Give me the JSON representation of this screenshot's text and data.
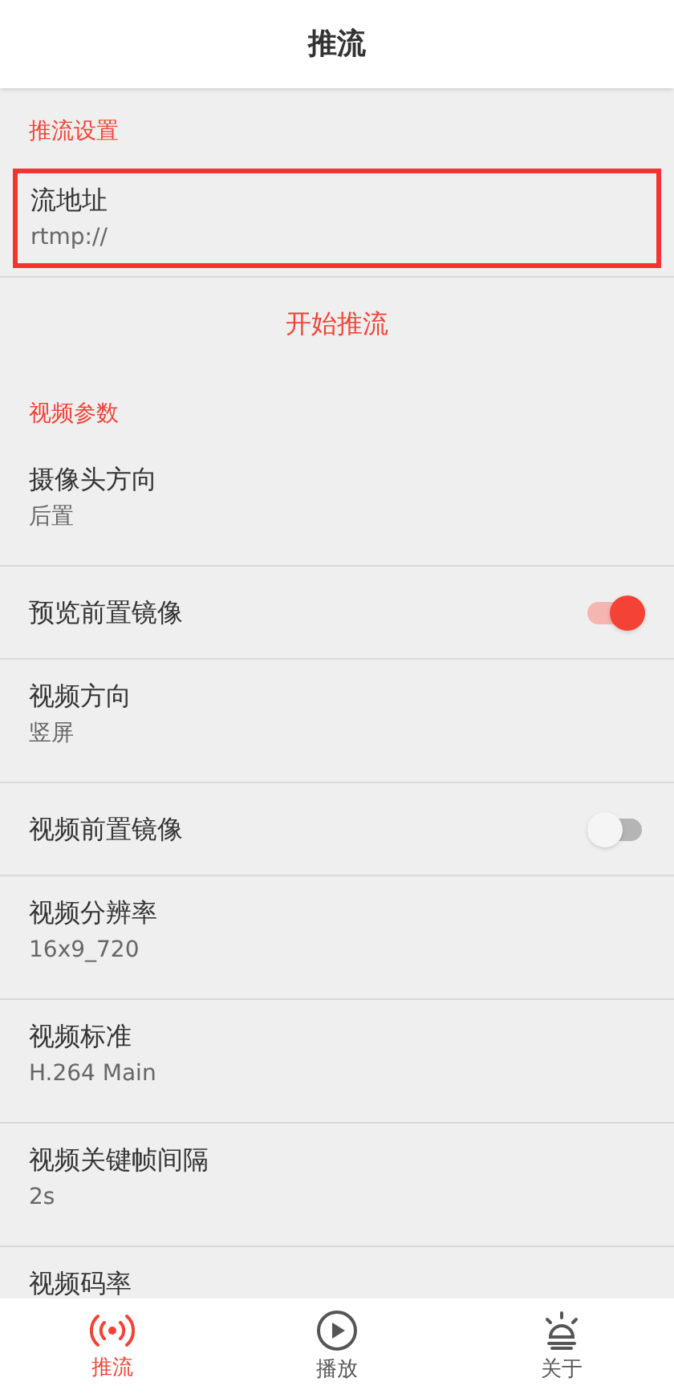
{
  "title": "推流",
  "sections": [
    {
      "header": "推流设置",
      "items": [
        {
          "kind": "value",
          "title": "流地址",
          "value": "rtmp://",
          "highlighted": true
        }
      ],
      "action": "开始推流"
    },
    {
      "header": "视频参数",
      "items": [
        {
          "kind": "value",
          "title": "摄像头方向",
          "value": "后置"
        },
        {
          "kind": "switch",
          "title": "预览前置镜像",
          "on": true
        },
        {
          "kind": "value",
          "title": "视频方向",
          "value": "竖屏"
        },
        {
          "kind": "switch",
          "title": "视频前置镜像",
          "on": false
        },
        {
          "kind": "value",
          "title": "视频分辨率",
          "value": "16x9_720"
        },
        {
          "kind": "value",
          "title": "视频标准",
          "value": "H.264 Main"
        },
        {
          "kind": "value",
          "title": "视频关键帧间隔",
          "value": "2s"
        },
        {
          "kind": "value",
          "title": "视频码率"
        }
      ]
    }
  ],
  "nav": [
    {
      "kind": "broadcast",
      "label": "推流",
      "selected": true
    },
    {
      "kind": "play",
      "label": "播放",
      "selected": false
    },
    {
      "kind": "alarm",
      "label": "关于",
      "selected": false
    }
  ]
}
